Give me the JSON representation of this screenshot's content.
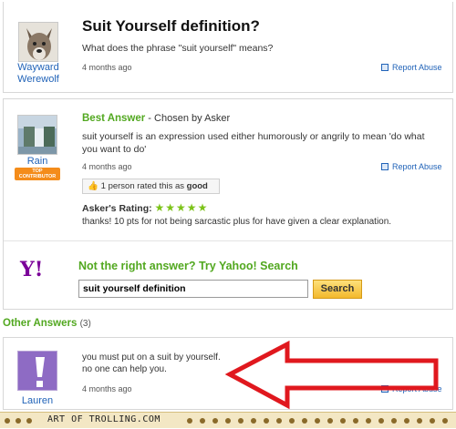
{
  "question": {
    "title": "Suit Yourself definition?",
    "details": "What does the phrase \"suit yourself\" means?",
    "asker_line1": "Wayward",
    "asker_line2": "Werewolf",
    "time": "4 months ago",
    "report_label": "Report Abuse"
  },
  "best_answer": {
    "heading": "Best Answer",
    "chosen_by": " - Chosen by Asker",
    "text": "suit yourself is an expression used either humorously or angrily to mean 'do what you want to do'",
    "author": "Rain",
    "badge_line1": "TOP",
    "badge_line2": "CONTRIBUTOR",
    "time": "4 months ago",
    "report_label": "Report Abuse",
    "rating_prefix": "1 person rated this as ",
    "rating_value": "good",
    "asker_rating_label": "Asker's Rating:",
    "stars": "★★★★★",
    "asker_comment": "thanks! 10 pts for not being sarcastic plus for have given a clear explanation."
  },
  "search_promo": {
    "logo": "Y!",
    "heading": "Not the right answer? Try Yahoo! Search",
    "query": "suit yourself definition",
    "button": "Search"
  },
  "other_answers": {
    "heading": "Other Answers",
    "count": "(3)",
    "items": [
      {
        "line1": "you must put on a suit by yourself.",
        "line2": "no one can help you.",
        "author": "Lauren",
        "time": "4 months ago",
        "report_label": "Report Abuse"
      }
    ]
  },
  "footer": {
    "text": "ART OF TROLLING.COM"
  },
  "colors": {
    "link_blue": "#2163b8",
    "accent_green": "#52a820",
    "yahoo_purple": "#7b0099",
    "arrow_red": "#e0181e"
  }
}
